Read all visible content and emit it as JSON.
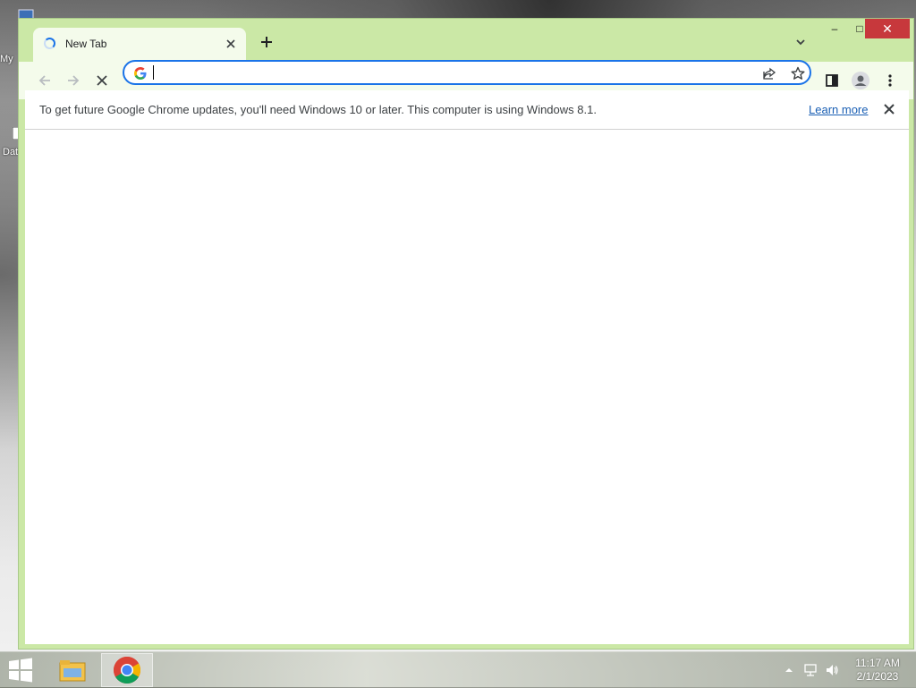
{
  "desktop": {
    "icons": [
      {
        "label": "My",
        "icon": "computer-icon"
      },
      {
        "label": "Dat",
        "icon": "database-icon"
      }
    ]
  },
  "browser": {
    "tab": {
      "title": "New Tab",
      "icon": "loading-spinner-icon"
    },
    "new_tab_icon": "plus-icon",
    "window_controls": {
      "minimize": "–",
      "maximize": "□",
      "close": "✕"
    },
    "toolbar": {
      "back_icon": "arrow-left-icon",
      "forward_icon": "arrow-right-icon",
      "stop_icon": "close-icon"
    },
    "omnibox": {
      "value": "",
      "placeholder": ""
    },
    "accent": "#1a73e8",
    "frame_color": "#cbe8a6"
  },
  "infobar": {
    "message": "To get future Google Chrome updates, you'll need Windows 10 or later. This computer is using Windows 8.1.",
    "link": "Learn more"
  },
  "taskbar": {
    "apps": [
      {
        "name": "File Explorer",
        "icon": "folder-icon"
      },
      {
        "name": "Google Chrome",
        "icon": "chrome-icon"
      }
    ],
    "clock": {
      "time": "11:17 AM",
      "date": "2/1/2023"
    }
  }
}
